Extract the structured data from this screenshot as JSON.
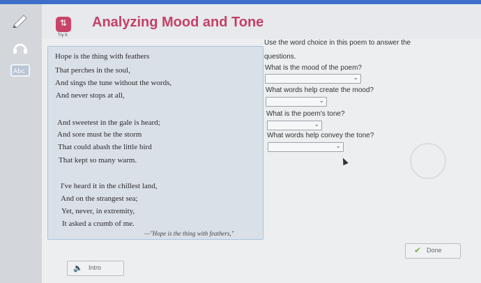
{
  "header": {
    "title": "Analyzing Mood and Tone",
    "badge_caption": "Try It"
  },
  "poem": {
    "lines": [
      "Hope is the thing with feathers",
      "That perches in the soul,",
      "And sings the tune without the words,",
      "And never stops at all,",
      "And sweetest in the gale is heard;",
      "And sore must be the storm",
      "That could abash the little bird",
      "That kept so many warm.",
      "I've heard it in the chillest land,",
      "And on the strangest sea;",
      "Yet, never, in extremity,",
      "It asked a crumb of me."
    ],
    "citation": "—\"Hope is the thing with feathers,\""
  },
  "questions": {
    "instruction_line1": "Use the word choice in this poem to answer the",
    "instruction_line2": "questions.",
    "items": [
      {
        "text": "What is the mood of the poem?",
        "selected": ""
      },
      {
        "text": "What words help create the mood?",
        "selected": ""
      },
      {
        "text": "What is the poem's tone?",
        "selected": ""
      },
      {
        "text": "What words help convey the tone?",
        "selected": ""
      }
    ]
  },
  "buttons": {
    "done": "Done",
    "intro": "Intro"
  },
  "toolbar": {
    "icons": [
      "pencil-icon",
      "headphones-icon",
      "dictionary-icon"
    ]
  },
  "colors": {
    "title": "#c44067",
    "badge": "#c94368",
    "topbar": "#3d6ec9",
    "poem_border": "#a9c4df",
    "done_check": "#7fb24f"
  }
}
